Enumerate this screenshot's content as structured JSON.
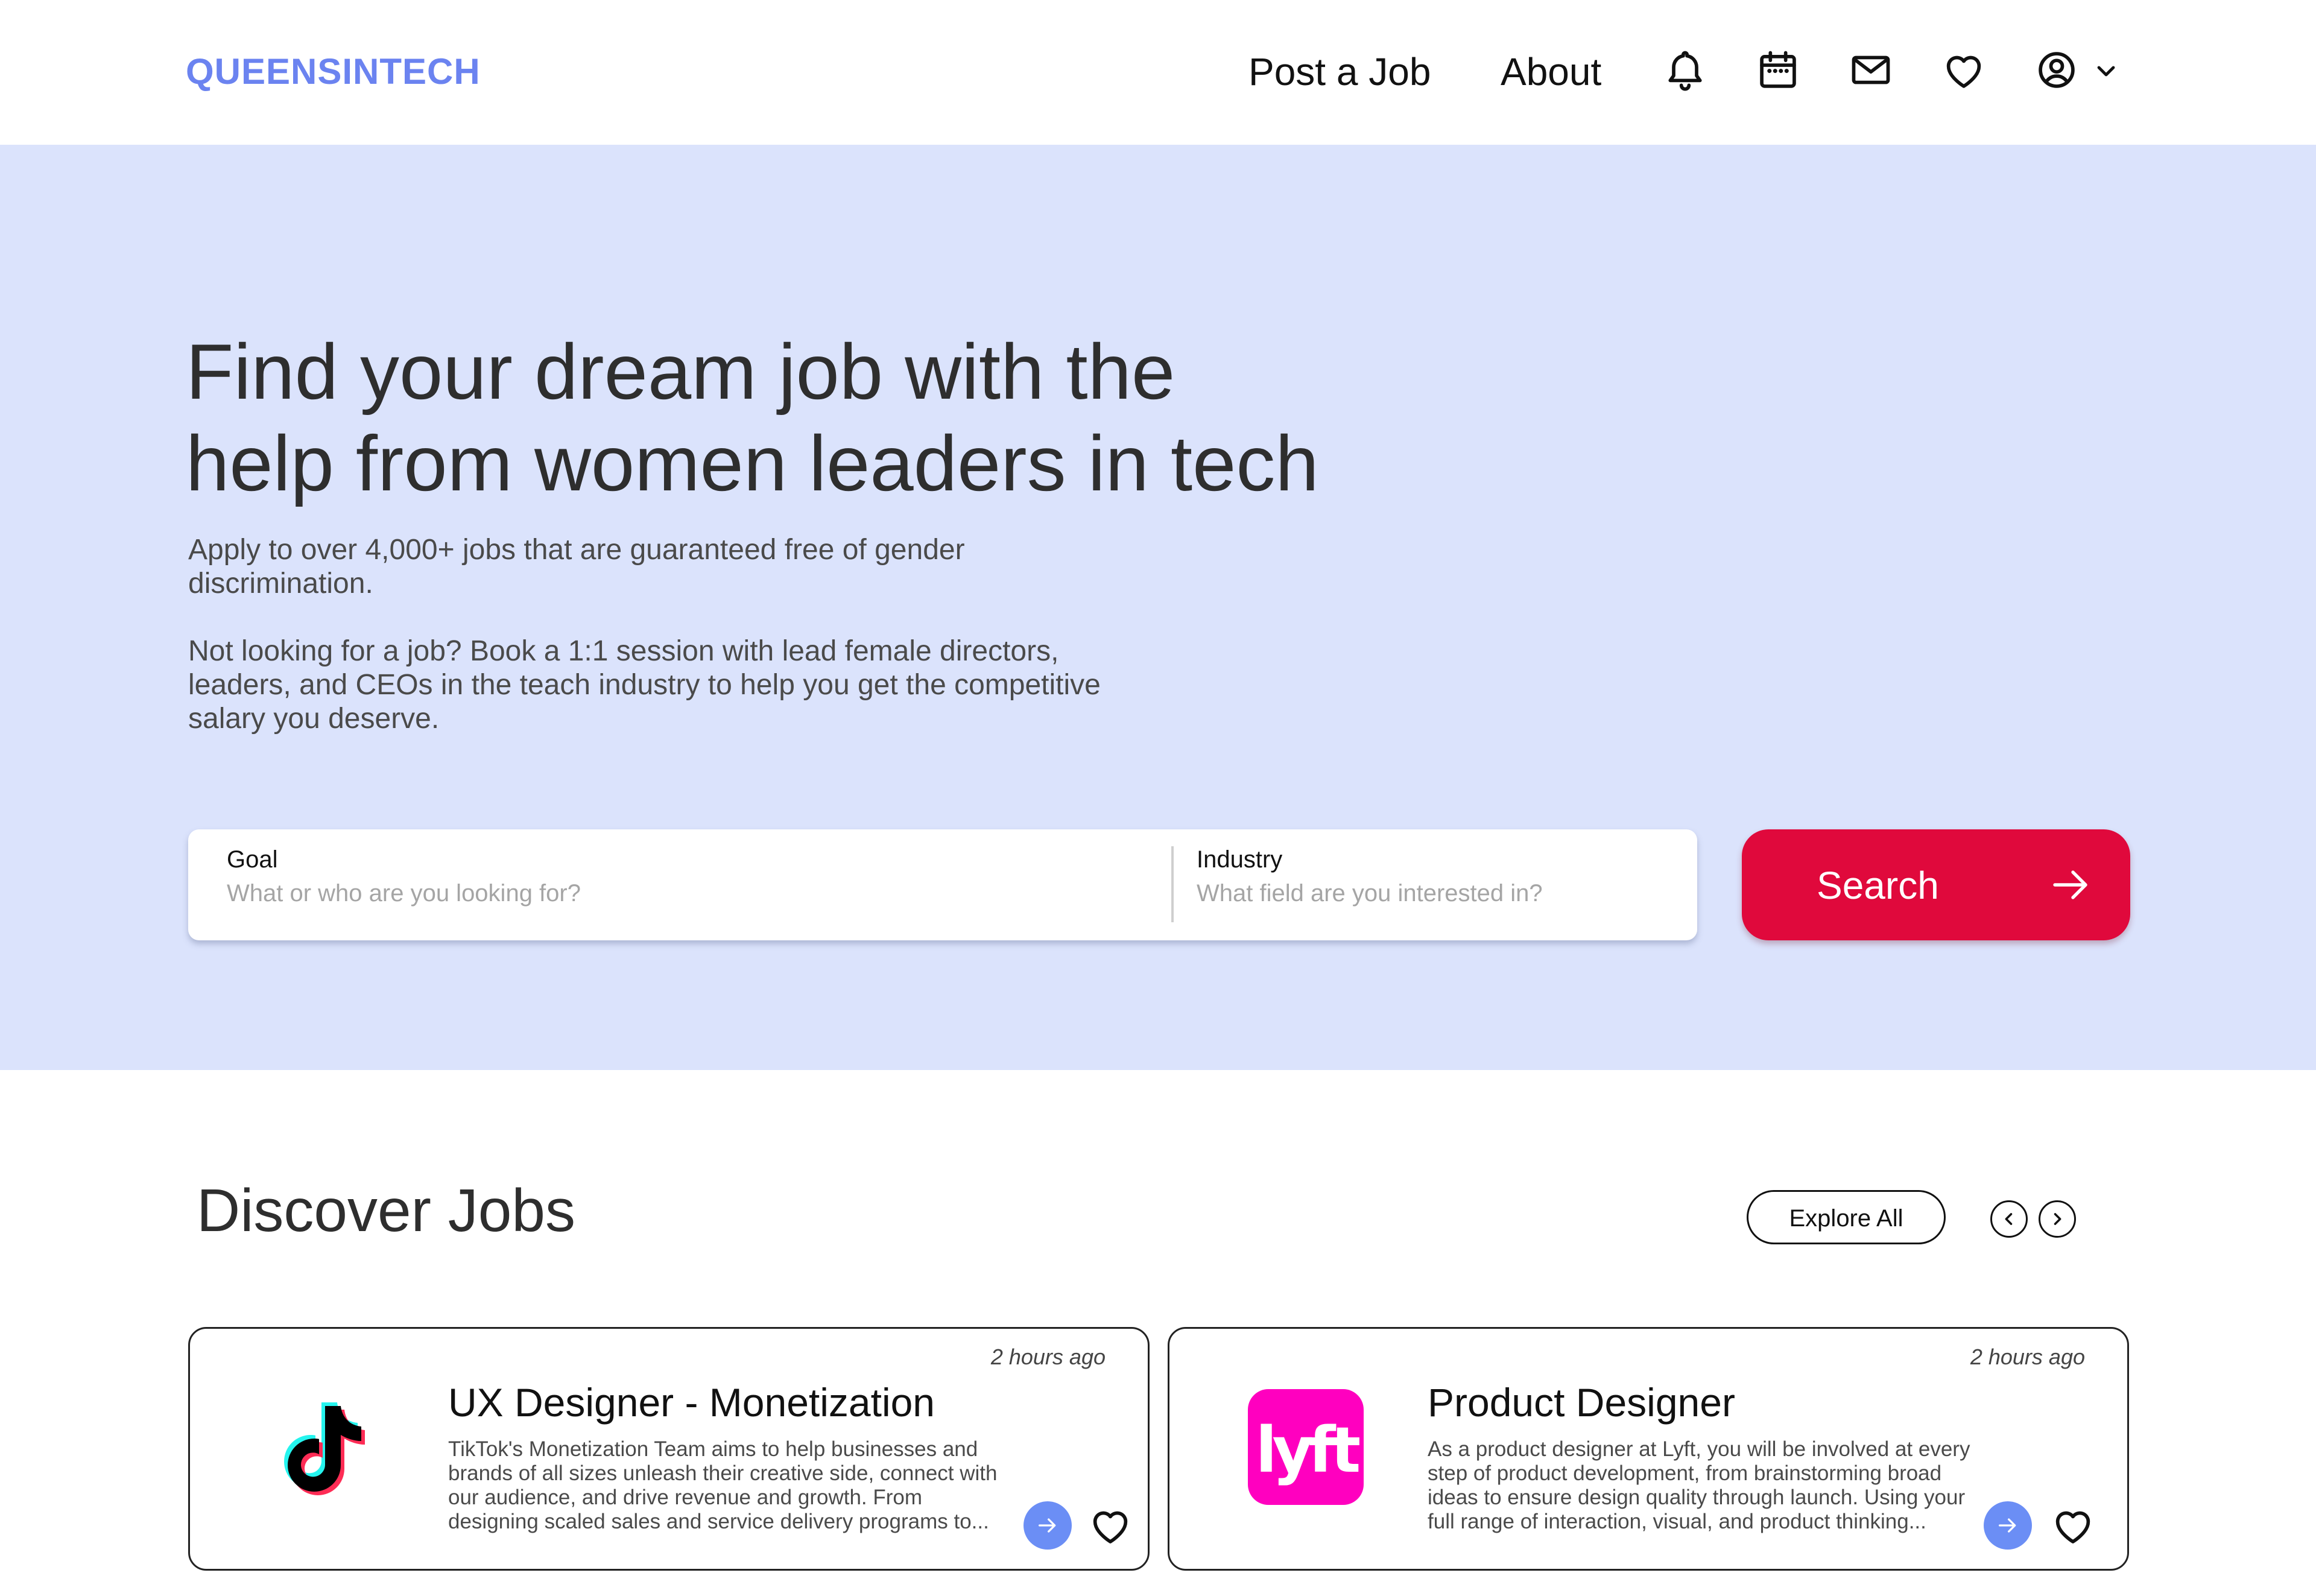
{
  "nav": {
    "logo": "QUEENSINTECH",
    "links": [
      "Post a Job",
      "About"
    ],
    "icons": [
      "bell-icon",
      "calendar-icon",
      "mail-icon",
      "heart-icon",
      "user-circle-icon",
      "chevron-down-icon"
    ]
  },
  "hero": {
    "title_line1": "Find your dream job with the",
    "title_line2": "help from women leaders in tech",
    "paragraph1": "Apply to over 4,000+ jobs that are guaranteed free of gender discrimination.",
    "paragraph2": "Not looking for a job? Book a 1:1 session with lead female directors, leaders, and CEOs in the teach industry to help you get the competitive salary you deserve.",
    "search": {
      "goal_label": "Goal",
      "goal_placeholder": "What or who are you looking for?",
      "industry_label": "Industry",
      "industry_placeholder": "What field are you interested in?",
      "button_label": "Search"
    }
  },
  "discover": {
    "title": "Discover Jobs",
    "explore_label": "Explore All",
    "jobs": [
      {
        "company_icon": "tiktok-logo",
        "time": "2 hours ago",
        "title": "UX Designer - Monetization",
        "description": "TikTok's Monetization Team aims to help businesses and brands of all sizes unleash their creative side, connect with our audience, and drive revenue and growth. From designing scaled sales and service delivery programs to..."
      },
      {
        "company_icon": "lyft-logo",
        "logo_text": "lyft",
        "time": "2 hours ago",
        "title": "Product Designer",
        "description": "As a product designer at Lyft, you will be involved at every step of product development, from brainstorming broad ideas to ensure design quality through launch. Using your full range of interaction, visual, and product thinking..."
      }
    ]
  },
  "colors": {
    "brand": "#6B83F0",
    "hero_bg": "#DBE3FC",
    "search_button": "#E0093C",
    "card_action": "#6B8EF5",
    "lyft_pink": "#FF00BF"
  }
}
